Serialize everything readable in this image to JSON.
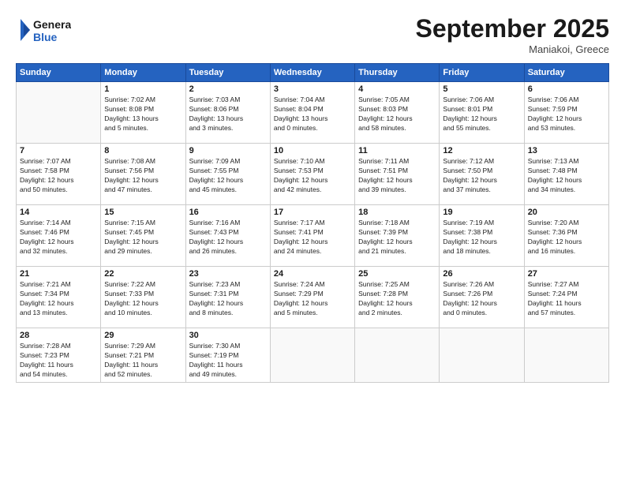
{
  "header": {
    "logo_line1": "General",
    "logo_line2": "Blue",
    "month": "September 2025",
    "location": "Maniakoi, Greece"
  },
  "weekdays": [
    "Sunday",
    "Monday",
    "Tuesday",
    "Wednesday",
    "Thursday",
    "Friday",
    "Saturday"
  ],
  "weeks": [
    [
      {
        "day": "",
        "info": ""
      },
      {
        "day": "1",
        "info": "Sunrise: 7:02 AM\nSunset: 8:08 PM\nDaylight: 13 hours\nand 5 minutes."
      },
      {
        "day": "2",
        "info": "Sunrise: 7:03 AM\nSunset: 8:06 PM\nDaylight: 13 hours\nand 3 minutes."
      },
      {
        "day": "3",
        "info": "Sunrise: 7:04 AM\nSunset: 8:04 PM\nDaylight: 13 hours\nand 0 minutes."
      },
      {
        "day": "4",
        "info": "Sunrise: 7:05 AM\nSunset: 8:03 PM\nDaylight: 12 hours\nand 58 minutes."
      },
      {
        "day": "5",
        "info": "Sunrise: 7:06 AM\nSunset: 8:01 PM\nDaylight: 12 hours\nand 55 minutes."
      },
      {
        "day": "6",
        "info": "Sunrise: 7:06 AM\nSunset: 7:59 PM\nDaylight: 12 hours\nand 53 minutes."
      }
    ],
    [
      {
        "day": "7",
        "info": "Sunrise: 7:07 AM\nSunset: 7:58 PM\nDaylight: 12 hours\nand 50 minutes."
      },
      {
        "day": "8",
        "info": "Sunrise: 7:08 AM\nSunset: 7:56 PM\nDaylight: 12 hours\nand 47 minutes."
      },
      {
        "day": "9",
        "info": "Sunrise: 7:09 AM\nSunset: 7:55 PM\nDaylight: 12 hours\nand 45 minutes."
      },
      {
        "day": "10",
        "info": "Sunrise: 7:10 AM\nSunset: 7:53 PM\nDaylight: 12 hours\nand 42 minutes."
      },
      {
        "day": "11",
        "info": "Sunrise: 7:11 AM\nSunset: 7:51 PM\nDaylight: 12 hours\nand 39 minutes."
      },
      {
        "day": "12",
        "info": "Sunrise: 7:12 AM\nSunset: 7:50 PM\nDaylight: 12 hours\nand 37 minutes."
      },
      {
        "day": "13",
        "info": "Sunrise: 7:13 AM\nSunset: 7:48 PM\nDaylight: 12 hours\nand 34 minutes."
      }
    ],
    [
      {
        "day": "14",
        "info": "Sunrise: 7:14 AM\nSunset: 7:46 PM\nDaylight: 12 hours\nand 32 minutes."
      },
      {
        "day": "15",
        "info": "Sunrise: 7:15 AM\nSunset: 7:45 PM\nDaylight: 12 hours\nand 29 minutes."
      },
      {
        "day": "16",
        "info": "Sunrise: 7:16 AM\nSunset: 7:43 PM\nDaylight: 12 hours\nand 26 minutes."
      },
      {
        "day": "17",
        "info": "Sunrise: 7:17 AM\nSunset: 7:41 PM\nDaylight: 12 hours\nand 24 minutes."
      },
      {
        "day": "18",
        "info": "Sunrise: 7:18 AM\nSunset: 7:39 PM\nDaylight: 12 hours\nand 21 minutes."
      },
      {
        "day": "19",
        "info": "Sunrise: 7:19 AM\nSunset: 7:38 PM\nDaylight: 12 hours\nand 18 minutes."
      },
      {
        "day": "20",
        "info": "Sunrise: 7:20 AM\nSunset: 7:36 PM\nDaylight: 12 hours\nand 16 minutes."
      }
    ],
    [
      {
        "day": "21",
        "info": "Sunrise: 7:21 AM\nSunset: 7:34 PM\nDaylight: 12 hours\nand 13 minutes."
      },
      {
        "day": "22",
        "info": "Sunrise: 7:22 AM\nSunset: 7:33 PM\nDaylight: 12 hours\nand 10 minutes."
      },
      {
        "day": "23",
        "info": "Sunrise: 7:23 AM\nSunset: 7:31 PM\nDaylight: 12 hours\nand 8 minutes."
      },
      {
        "day": "24",
        "info": "Sunrise: 7:24 AM\nSunset: 7:29 PM\nDaylight: 12 hours\nand 5 minutes."
      },
      {
        "day": "25",
        "info": "Sunrise: 7:25 AM\nSunset: 7:28 PM\nDaylight: 12 hours\nand 2 minutes."
      },
      {
        "day": "26",
        "info": "Sunrise: 7:26 AM\nSunset: 7:26 PM\nDaylight: 12 hours\nand 0 minutes."
      },
      {
        "day": "27",
        "info": "Sunrise: 7:27 AM\nSunset: 7:24 PM\nDaylight: 11 hours\nand 57 minutes."
      }
    ],
    [
      {
        "day": "28",
        "info": "Sunrise: 7:28 AM\nSunset: 7:23 PM\nDaylight: 11 hours\nand 54 minutes."
      },
      {
        "day": "29",
        "info": "Sunrise: 7:29 AM\nSunset: 7:21 PM\nDaylight: 11 hours\nand 52 minutes."
      },
      {
        "day": "30",
        "info": "Sunrise: 7:30 AM\nSunset: 7:19 PM\nDaylight: 11 hours\nand 49 minutes."
      },
      {
        "day": "",
        "info": ""
      },
      {
        "day": "",
        "info": ""
      },
      {
        "day": "",
        "info": ""
      },
      {
        "day": "",
        "info": ""
      }
    ]
  ]
}
